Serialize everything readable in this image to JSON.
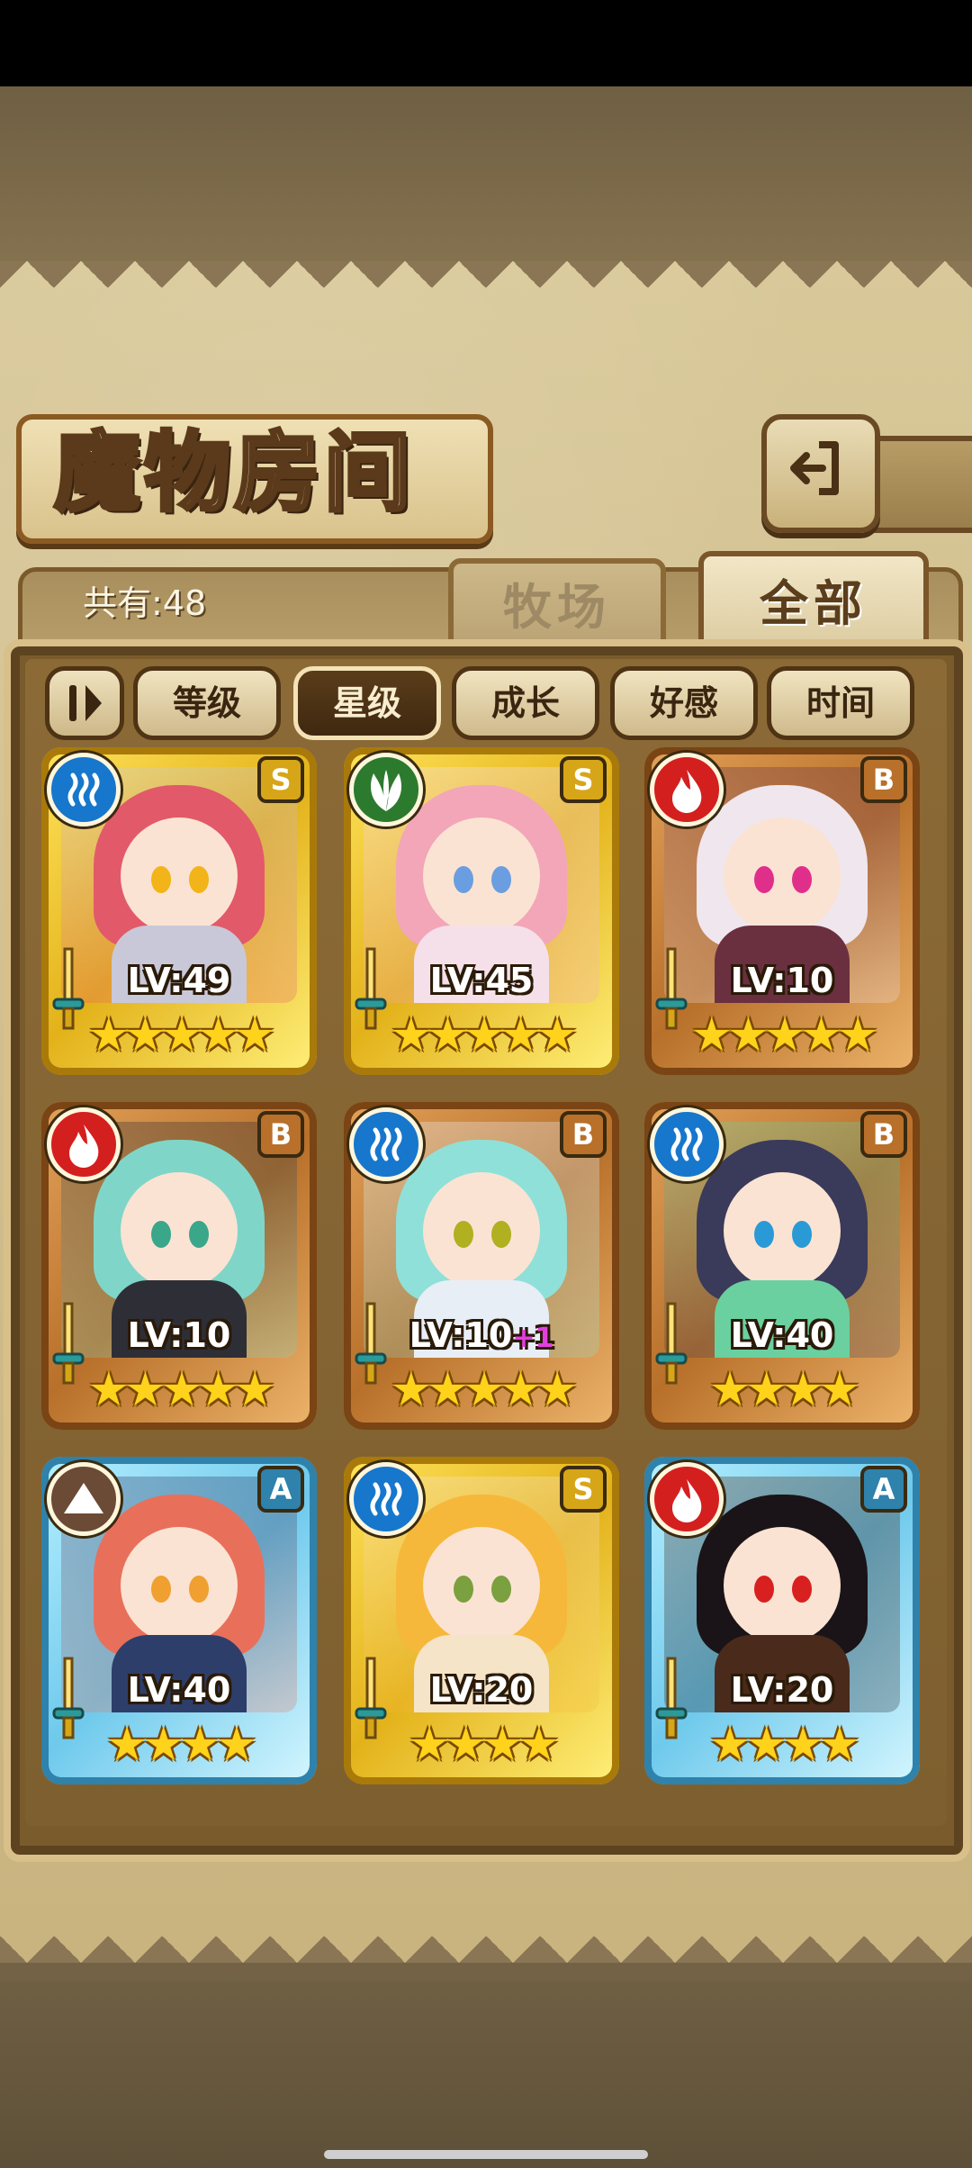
{
  "screen": {
    "title": "魔物房间",
    "count_label": "共有:48",
    "tabs": [
      {
        "label": "牧场",
        "active": false
      },
      {
        "label": "全部",
        "active": true
      }
    ],
    "sort_buttons": [
      {
        "label": "等级",
        "active": false
      },
      {
        "label": "星级",
        "active": true
      },
      {
        "label": "成长",
        "active": false
      },
      {
        "label": "好感",
        "active": false
      },
      {
        "label": "时间",
        "active": false
      }
    ]
  },
  "monsters": [
    {
      "rank": "S",
      "element": "water-icon",
      "level": "LV:49",
      "plus": "",
      "stars": "★★★★★",
      "frame": "gold",
      "hair": "#e2596a",
      "body": "#c8c8d8",
      "eye": "#f2b418"
    },
    {
      "rank": "S",
      "element": "leaf-icon",
      "level": "LV:45",
      "plus": "",
      "stars": "★★★★★",
      "frame": "gold",
      "hair": "#f2a6b8",
      "body": "#f5e0ea",
      "eye": "#6a9ee0"
    },
    {
      "rank": "B",
      "element": "fire-icon",
      "level": "LV:10",
      "plus": "",
      "stars": "★★★★★",
      "frame": "bronze",
      "hair": "#f0e6ee",
      "body": "#6a3040",
      "eye": "#e02f8a"
    },
    {
      "rank": "B",
      "element": "fire-icon",
      "level": "LV:10",
      "plus": "",
      "stars": "★★★★★",
      "frame": "bronze",
      "hair": "#7fd6c8",
      "body": "#2e2e36",
      "eye": "#3aa68a"
    },
    {
      "rank": "B",
      "element": "water-icon",
      "level": "LV:10",
      "plus": "+1",
      "stars": "★★★★★",
      "frame": "bronze",
      "hair": "#8fe0d8",
      "body": "#e8eef6",
      "eye": "#b0b020"
    },
    {
      "rank": "B",
      "element": "water-icon",
      "level": "LV:40",
      "plus": "",
      "stars": "★★★★",
      "frame": "bronze",
      "hair": "#3a3a5a",
      "body": "#6ad0a0",
      "eye": "#2a9ad6"
    },
    {
      "rank": "A",
      "element": "earth-icon",
      "level": "LV:40",
      "plus": "",
      "stars": "★★★★",
      "frame": "blue",
      "hair": "#e8705a",
      "body": "#2e3e6a",
      "eye": "#f0a030"
    },
    {
      "rank": "S",
      "element": "water-icon",
      "level": "LV:20",
      "plus": "",
      "stars": "★★★★",
      "frame": "gold",
      "hair": "#f6b83a",
      "body": "#f6e4c8",
      "eye": "#7aa040"
    },
    {
      "rank": "A",
      "element": "fire-icon",
      "level": "LV:20",
      "plus": "",
      "stars": "★★★★",
      "frame": "blue",
      "hair": "#1a1418",
      "body": "#4a2a1a",
      "eye": "#d82020"
    }
  ]
}
